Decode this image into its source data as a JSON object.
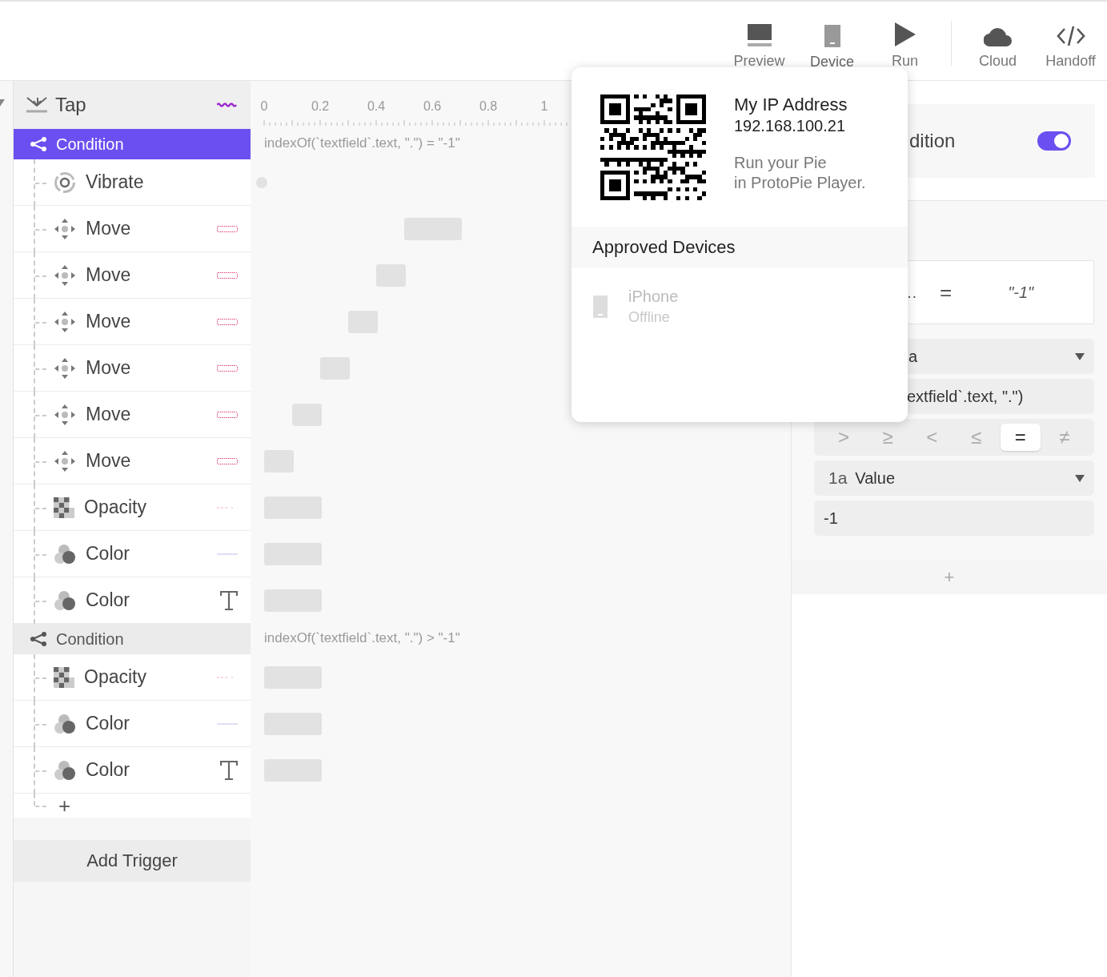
{
  "toolbar_groups": [
    {
      "items": [
        {
          "label": "Preview",
          "kind": "preview",
          "selected": false
        },
        {
          "label": "Device",
          "kind": "device",
          "selected": true
        },
        {
          "label": "Run",
          "kind": "run",
          "selected": false
        }
      ]
    },
    {
      "items": [
        {
          "label": "Cloud",
          "kind": "cloud",
          "selected": false
        },
        {
          "label": "Handoff",
          "kind": "code",
          "selected": false
        }
      ]
    }
  ],
  "trigger": {
    "label": "Tap"
  },
  "conditions": [
    {
      "label": "Condition",
      "selected": true,
      "expression": "indexOf(`textfield`.text, \".\") = \"-1\"",
      "responses": [
        {
          "kind": "vibrate",
          "label": "Vibrate"
        },
        {
          "kind": "move",
          "label": "Move"
        },
        {
          "kind": "move",
          "label": "Move"
        },
        {
          "kind": "move",
          "label": "Move"
        },
        {
          "kind": "move",
          "label": "Move"
        },
        {
          "kind": "move",
          "label": "Move"
        },
        {
          "kind": "move",
          "label": "Move"
        },
        {
          "kind": "opacity",
          "label": "Opacity"
        },
        {
          "kind": "color",
          "label": "Color"
        },
        {
          "kind": "color",
          "label": "Color",
          "layer": {
            "kind": "text"
          }
        }
      ]
    },
    {
      "label": "Condition",
      "selected": false,
      "expression": "indexOf(`textfield`.text, \".\") > \"-1\"",
      "responses": [
        {
          "kind": "opacity",
          "label": "Opacity"
        },
        {
          "kind": "color",
          "label": "Color"
        },
        {
          "kind": "color",
          "label": "Color",
          "layer": {
            "kind": "text"
          }
        }
      ]
    }
  ],
  "timeline": {
    "ticks": [
      "0",
      "0.2",
      "0.4",
      "0.6",
      "0.8",
      "1"
    ]
  },
  "add_response": "+",
  "add_trigger": "Add Trigger",
  "popup": {
    "title": "My IP Address",
    "ip": "192.168.100.21",
    "hint": "Run your Pie\nin ProtoPie Player.",
    "section": "Approved Devices",
    "devices": [
      {
        "name": "iPhone",
        "status": "Offline",
        "online": false
      }
    ]
  },
  "inspector": {
    "title": "dition",
    "enabled": true,
    "summary": {
      "left": "…",
      "operator": "=",
      "right": "\"-1\""
    },
    "source": {
      "label": "a"
    },
    "source_value": "extfield`.text, \".\")",
    "operators": [
      {
        "symbol": ">",
        "selected": false
      },
      {
        "symbol": "≥",
        "selected": false
      },
      {
        "symbol": "<",
        "selected": false
      },
      {
        "symbol": "≤",
        "selected": false
      },
      {
        "symbol": "=",
        "selected": true
      },
      {
        "symbol": "≠",
        "selected": false
      }
    ],
    "target": {
      "type": "1a",
      "label": "Value"
    },
    "target_value": "-1",
    "add": "+"
  }
}
